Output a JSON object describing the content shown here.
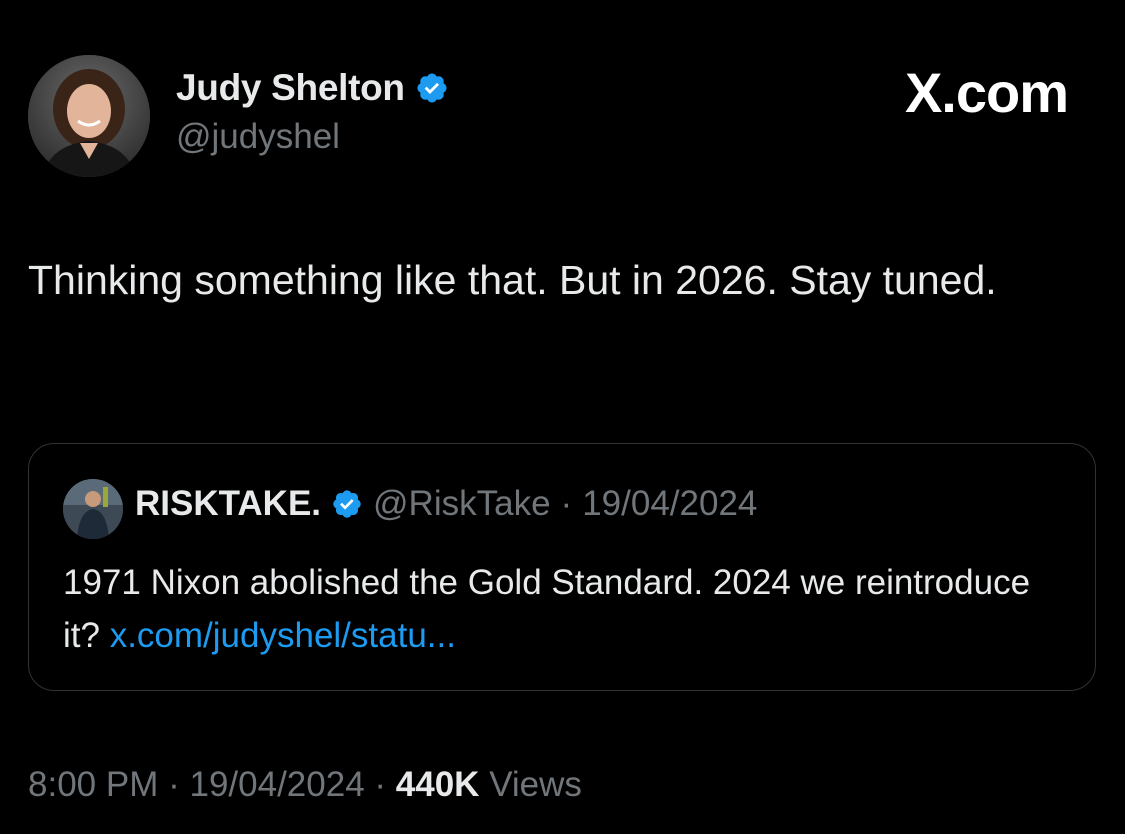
{
  "author": {
    "name": "Judy Shelton",
    "handle": "@judyshel",
    "verified": true
  },
  "brand": {
    "label": "X.com"
  },
  "tweet": {
    "text": "Thinking something like that. But in 2026. Stay tuned."
  },
  "quote": {
    "name": "RISKTAKE.",
    "verified": true,
    "handle": "@RiskTake",
    "separator": "·",
    "date": "19/04/2024",
    "text": "1971 Nixon abolished the Gold Standard. 2024 we reintroduce it?",
    "link": "x.com/judyshel/statu..."
  },
  "meta": {
    "time": "8:00 PM",
    "separator1": "·",
    "date": "19/04/2024",
    "separator2": "·",
    "views_count": "440K",
    "views_label": "Views"
  },
  "colors": {
    "background": "#000000",
    "primary_text": "#e7e9ea",
    "secondary_text": "#71767b",
    "link": "#1d9bf0",
    "verified_badge": "#1d9bf0",
    "card_border": "#2f3336"
  },
  "icons": {
    "verified": "verified-badge-icon"
  }
}
